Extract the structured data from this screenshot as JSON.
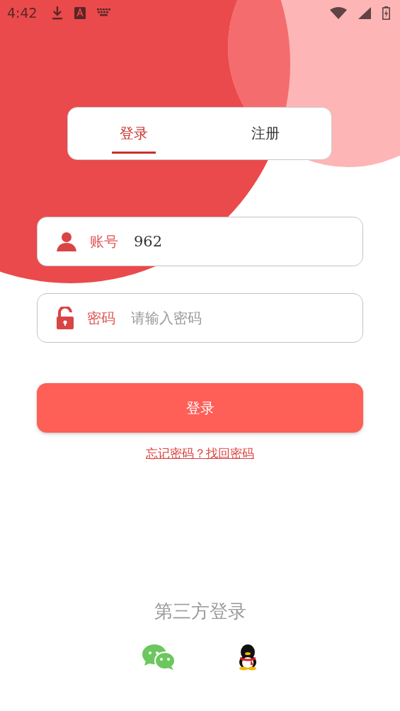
{
  "status_bar": {
    "time": "4:42"
  },
  "tabs": [
    {
      "label": "登录",
      "selected": true
    },
    {
      "label": "注册",
      "selected": false
    }
  ],
  "fields": [
    {
      "kind": "account",
      "label": "账号",
      "value": "962"
    },
    {
      "kind": "password",
      "label": "密码",
      "placeholder": "请输入密码"
    }
  ],
  "login_button": "登录",
  "forgot_link": "忘记密码？找回密码",
  "third_party": {
    "title": "第三方登录",
    "providers": [
      {
        "kind": "wechat"
      },
      {
        "kind": "qq"
      }
    ]
  }
}
